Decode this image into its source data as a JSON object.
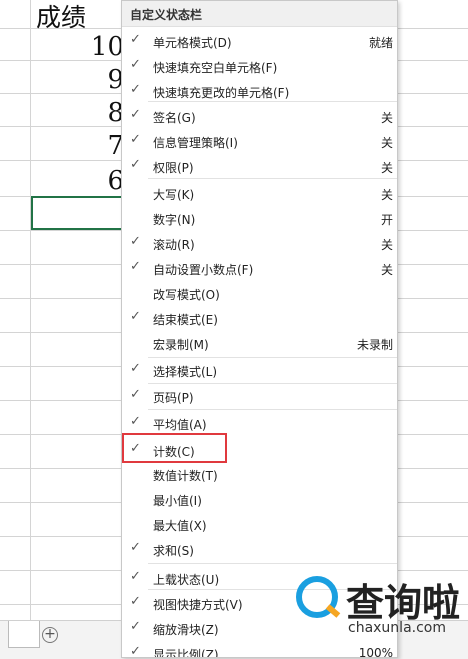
{
  "sheet": {
    "header": "成绩",
    "scores": [
      "10",
      "9",
      "8",
      "7",
      "6"
    ]
  },
  "menu": {
    "title": "自定义状态栏",
    "items": [
      {
        "label": "单元格模式(D)",
        "value": "就绪",
        "checked": true
      },
      {
        "label": "快速填充空白单元格(F)",
        "value": "",
        "checked": true
      },
      {
        "label": "快速填充更改的单元格(F)",
        "value": "",
        "checked": true
      },
      {
        "label": "签名(G)",
        "value": "关",
        "checked": true
      },
      {
        "label": "信息管理策略(I)",
        "value": "关",
        "checked": true
      },
      {
        "label": "权限(P)",
        "value": "关",
        "checked": true
      },
      {
        "label": "大写(K)",
        "value": "关",
        "checked": false
      },
      {
        "label": "数字(N)",
        "value": "开",
        "checked": false
      },
      {
        "label": "滚动(R)",
        "value": "关",
        "checked": true
      },
      {
        "label": "自动设置小数点(F)",
        "value": "关",
        "checked": true
      },
      {
        "label": "改写模式(O)",
        "value": "",
        "checked": false
      },
      {
        "label": "结束模式(E)",
        "value": "",
        "checked": true
      },
      {
        "label": "宏录制(M)",
        "value": "未录制",
        "checked": false
      },
      {
        "label": "选择模式(L)",
        "value": "",
        "checked": true
      },
      {
        "label": "页码(P)",
        "value": "",
        "checked": true
      },
      {
        "label": "平均值(A)",
        "value": "",
        "checked": true
      },
      {
        "label": "计数(C)",
        "value": "",
        "checked": true
      },
      {
        "label": "数值计数(T)",
        "value": "",
        "checked": false
      },
      {
        "label": "最小值(I)",
        "value": "",
        "checked": false
      },
      {
        "label": "最大值(X)",
        "value": "",
        "checked": false
      },
      {
        "label": "求和(S)",
        "value": "",
        "checked": true
      },
      {
        "label": "上载状态(U)",
        "value": "",
        "checked": true
      },
      {
        "label": "视图快捷方式(V)",
        "value": "",
        "checked": true
      },
      {
        "label": "缩放滑块(Z)",
        "value": "",
        "checked": true
      },
      {
        "label": "显示比例(Z)",
        "value": "100%",
        "checked": true
      }
    ]
  },
  "watermark": {
    "text": "查询啦",
    "url": "chaxunla.com"
  },
  "colors": {
    "highlight": "#e0393e",
    "active_cell": "#217346",
    "watermark_blue": "#1a9fe0",
    "watermark_orange": "#f5a623"
  },
  "icons": {
    "check": "check-icon",
    "add_sheet": "plus-circle-icon"
  }
}
